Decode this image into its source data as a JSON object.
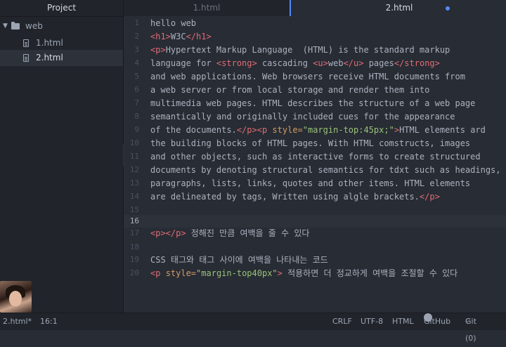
{
  "sidebar": {
    "header": "Project",
    "folder": "web",
    "files": [
      "1.html",
      "2.html"
    ]
  },
  "tabs": [
    {
      "label": "1.html"
    },
    {
      "label": "2.html"
    }
  ],
  "editor": {
    "lines": [
      {
        "n": "1"
      },
      {
        "n": "2"
      },
      {
        "n": "3"
      },
      {
        "n": "4"
      },
      {
        "n": "5"
      },
      {
        "n": "6"
      },
      {
        "n": "7"
      },
      {
        "n": "8"
      },
      {
        "n": "9"
      },
      {
        "n": "10"
      },
      {
        "n": "11"
      },
      {
        "n": "12"
      },
      {
        "n": "13"
      },
      {
        "n": "14"
      },
      {
        "n": "15"
      },
      {
        "n": "16"
      },
      {
        "n": "17"
      },
      {
        "n": "18"
      },
      {
        "n": "19"
      },
      {
        "n": "20"
      }
    ],
    "t": {
      "l1": "hello web",
      "l2_a": "<h1>",
      "l2_b": "W3C",
      "l2_c": "</h1>",
      "l3_a": "<p>",
      "l3_b": "Hypertext Markup Language  (HTML) is the standard markup",
      "l4_a": "language for ",
      "l4_b": "<strong>",
      "l4_c": " cascading ",
      "l4_d": "<u>",
      "l4_e": "web",
      "l4_f": "</u>",
      "l4_g": " pages",
      "l4_h": "</strong>",
      "l5": "and web applications. Web browsers receive HTML documents from",
      "l6": "a web server or from local storage and render them into",
      "l7": "multimedia web pages. HTML describes the structure of a web page",
      "l8": "semantically and originally included cues for the appearance",
      "l9_a": "of the documents.",
      "l9_b": "</p>",
      "l9_c": "<p ",
      "l9_d": "style=",
      "l9_e": "\"margin-top:45px;\"",
      "l9_f": ">",
      "l9_g": "HTML elements ard",
      "l10": "the building blocks of HTML pages. With HTML comstructs, images",
      "l11": "and other objects, such as interactive forms to create structured",
      "l12": "documents by denoting structural semantics for tdxt such as headings,",
      "l13": "paragraphs, lists, links, quotes and other items. HTML elements",
      "l14_a": "are delineated by tags, Written using algle brackets.",
      "l14_b": "</p>",
      "l17_a": "<p></p>",
      "l17_b": " 정해진 만큼 여백을 줄 수 있다",
      "l19": "CSS 태그와 태그 사이에 여백을 나타내는 코드",
      "l20_a": "<p ",
      "l20_b": "style=",
      "l20_c": "\"margin-top40px\"",
      "l20_d": ">",
      "l20_e": " 적용하면 더 정교하게 여백을 조절할 수 있다"
    }
  },
  "status": {
    "file": "2.html*",
    "cursor": "16:1",
    "line_ending": "CRLF",
    "encoding": "UTF-8",
    "grammar": "HTML",
    "github": "GitHub",
    "git": "Git (0)"
  },
  "colors": {
    "accent": "#528bff",
    "tag": "#e06c75",
    "attr": "#d19a66",
    "string": "#98c379"
  }
}
